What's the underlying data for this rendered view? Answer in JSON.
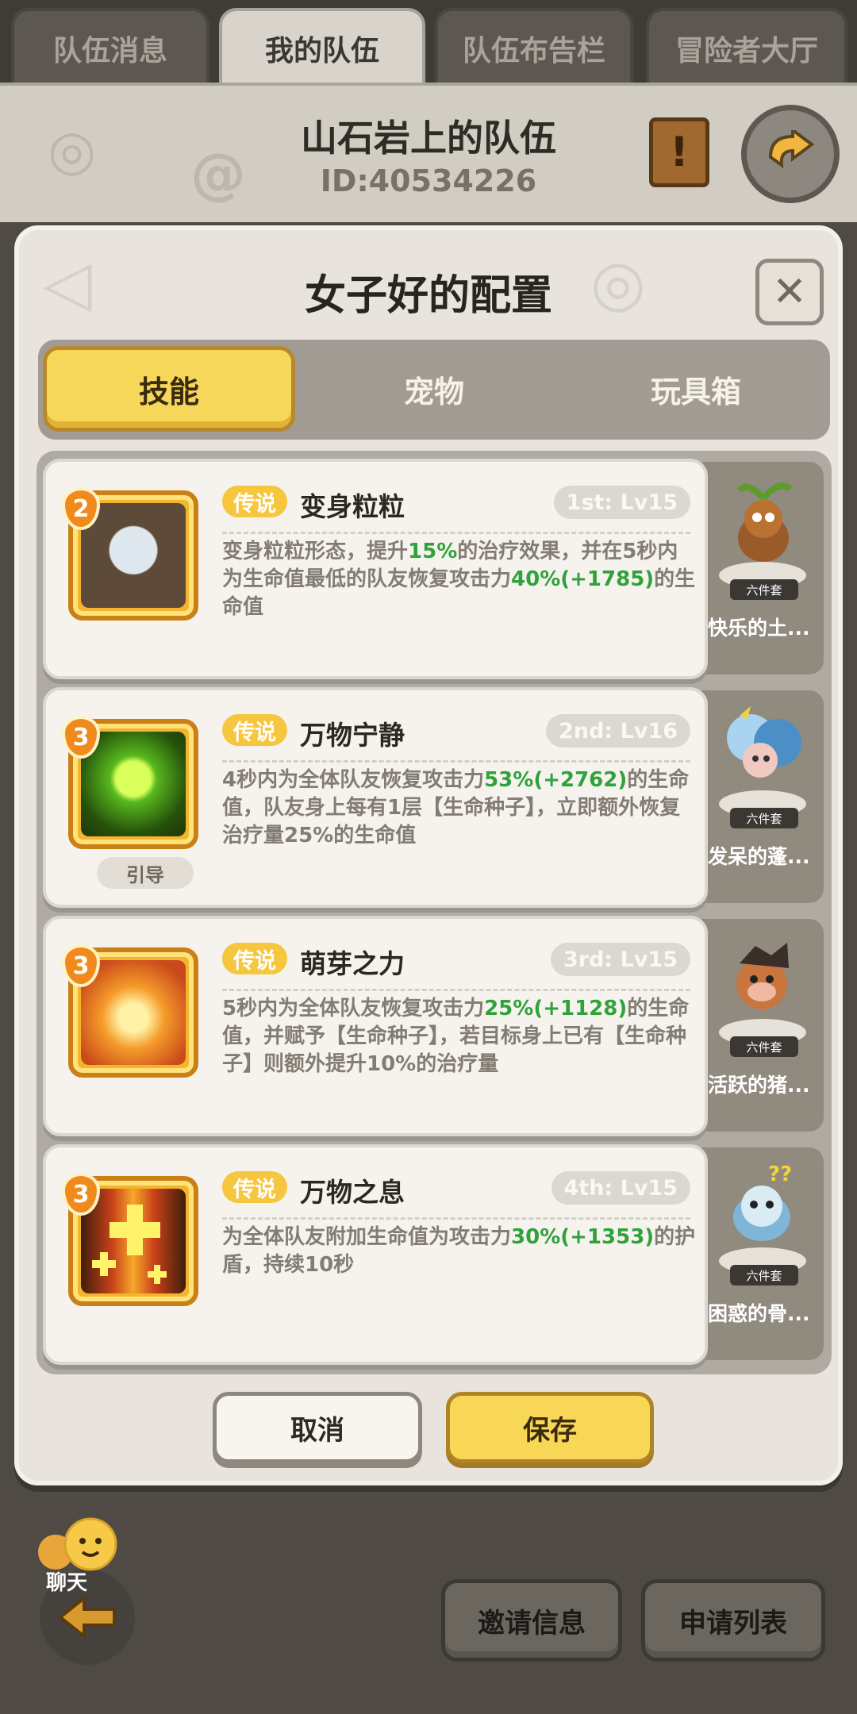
{
  "top_tabs": [
    {
      "label": "队伍消息",
      "active": false
    },
    {
      "label": "我的队伍",
      "active": true
    },
    {
      "label": "队伍布告栏",
      "active": false
    },
    {
      "label": "冒险者大厅",
      "active": false
    }
  ],
  "team": {
    "name": "山石岩上的队伍",
    "id": "ID:40534226"
  },
  "modal": {
    "title": "女子好的配置",
    "tabs": [
      {
        "label": "技能",
        "active": true
      },
      {
        "label": "宠物",
        "active": false
      },
      {
        "label": "玩具箱",
        "active": false
      }
    ],
    "skills": [
      {
        "level": "2",
        "rarity": "传说",
        "name": "变身粒粒",
        "slot": "1st: Lv15",
        "desc_parts": [
          "变身粒粒形态，提升",
          "15%",
          "的治疗效果，并在5秒内为生命值最低的队友恢复攻击力",
          "40%(+1785)",
          "的生命值"
        ],
        "guide": "",
        "pet": {
          "set": "六件套",
          "name": "快乐的土..."
        }
      },
      {
        "level": "3",
        "rarity": "传说",
        "name": "万物宁静",
        "slot": "2nd: Lv16",
        "desc_parts": [
          "4秒内为全体队友恢复攻击力",
          "53%(+2762)",
          "的生命值，队友身上每有1层【生命种子】，立即额外恢复治疗量25%的生命值",
          "",
          ""
        ],
        "guide": "引导",
        "pet": {
          "set": "六件套",
          "name": "发呆的蓬..."
        }
      },
      {
        "level": "3",
        "rarity": "传说",
        "name": "萌芽之力",
        "slot": "3rd: Lv15",
        "desc_parts": [
          "5秒内为全体队友恢复攻击力",
          "25%(+1128)",
          "的生命值，并赋予【生命种子】，若目标身上已有【生命种子】则额外提升10%的治疗量",
          "",
          ""
        ],
        "guide": "",
        "pet": {
          "set": "六件套",
          "name": "活跃的猪..."
        }
      },
      {
        "level": "3",
        "rarity": "传说",
        "name": "万物之息",
        "slot": "4th: Lv15",
        "desc_parts": [
          "为全体队友附加生命值为攻击力",
          "30%(+1353)",
          "的护盾，持续10秒",
          "",
          ""
        ],
        "guide": "",
        "pet": {
          "set": "六件套",
          "name": "困惑的骨..."
        }
      }
    ],
    "cancel_label": "取消",
    "save_label": "保存"
  },
  "bottom": {
    "chat_label": "聊天",
    "invite_label": "邀请信息",
    "apply_label": "申请列表"
  },
  "colors": {
    "accent_yellow": "#f8d656",
    "highlight_green": "#2fa23c",
    "rarity_gold": "#f6c63e",
    "badge_orange": "#f08a1d"
  }
}
